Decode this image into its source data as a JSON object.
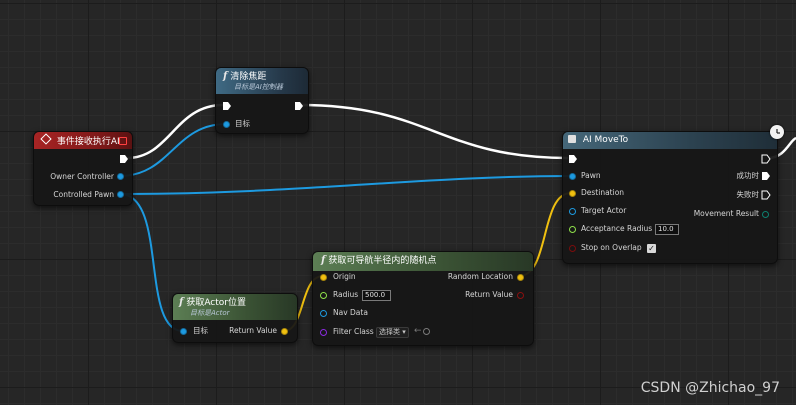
{
  "nodes": {
    "event": {
      "title": "事件接收执行AI",
      "pins": {
        "owner_controller": "Owner Controller",
        "controlled_pawn": "Controlled Pawn"
      }
    },
    "clear_focus": {
      "title": "清除焦距",
      "subtitle": "目标是AI控制器",
      "pins": {
        "target": "目标"
      }
    },
    "get_actor_location": {
      "title": "获取Actor位置",
      "subtitle": "目标是Actor",
      "pins": {
        "target": "目标",
        "return_value": "Return Value"
      }
    },
    "get_random_point": {
      "title": "获取可导航半径内的随机点",
      "pins": {
        "origin": "Origin",
        "radius": "Radius",
        "radius_value": "500.0",
        "nav_data": "Nav Data",
        "filter_class": "Filter Class",
        "filter_select": "选择类",
        "random_location": "Random Location",
        "return_value": "Return Value"
      }
    },
    "ai_move_to": {
      "title": "AI MoveTo",
      "pins": {
        "pawn": "Pawn",
        "destination": "Destination",
        "target_actor": "Target Actor",
        "acceptance_radius": "Acceptance Radius",
        "acceptance_radius_value": "10.0",
        "stop_on_overlap": "Stop on Overlap",
        "on_success": "成功时",
        "on_fail": "失败时",
        "movement_result": "Movement Result"
      }
    }
  },
  "colors": {
    "exec": "#ffffff",
    "object": "#1d9ae0",
    "vector": "#f0c010",
    "float": "#8ee04a",
    "class": "#8a2ae0",
    "bool": "#7a0c0c",
    "enum": "#0c8070",
    "event_header": "#a82424",
    "function_header": "#3f6a84",
    "pure_header": "#5c7e54"
  },
  "watermark": "CSDN @Zhichao_97"
}
